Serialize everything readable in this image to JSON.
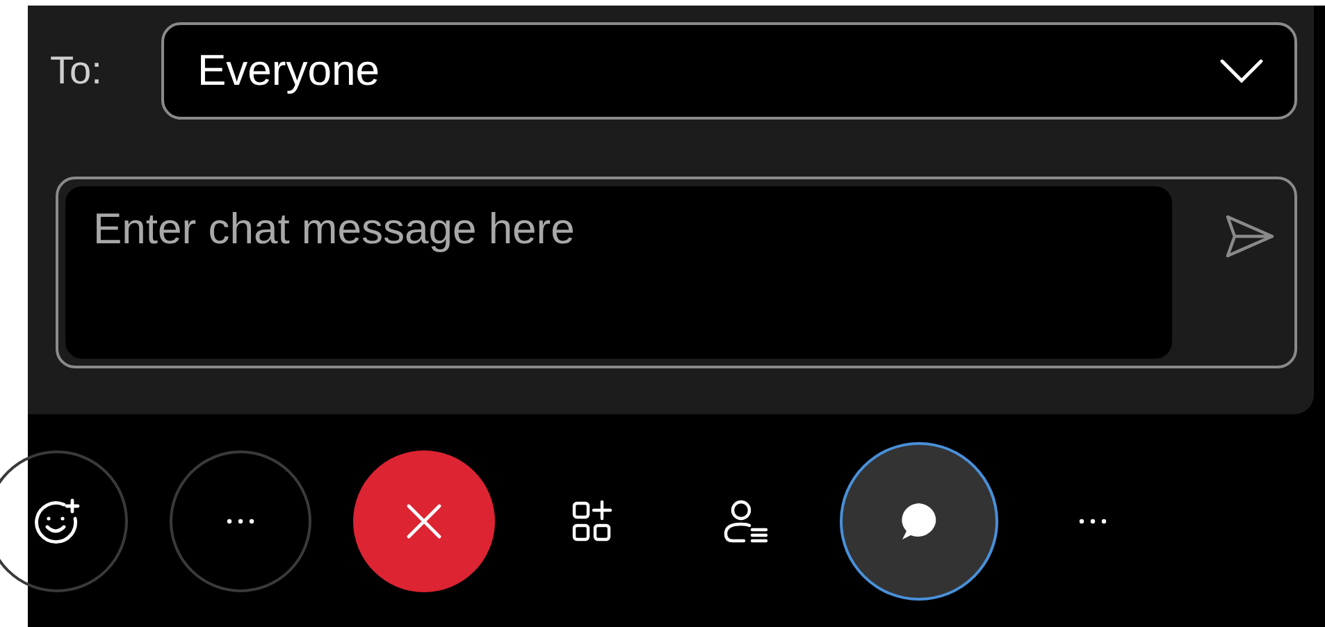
{
  "recipient": {
    "label": "To:",
    "value": "Everyone"
  },
  "message": {
    "placeholder": "Enter chat message here"
  },
  "toolbar": [
    {
      "kind": "reaction",
      "selected": false
    },
    {
      "kind": "more",
      "selected": false
    },
    {
      "kind": "leave",
      "selected": false
    },
    {
      "kind": "apps",
      "selected": false
    },
    {
      "kind": "participants",
      "selected": false
    },
    {
      "kind": "chat",
      "selected": true
    },
    {
      "kind": "overflow",
      "selected": false
    }
  ]
}
